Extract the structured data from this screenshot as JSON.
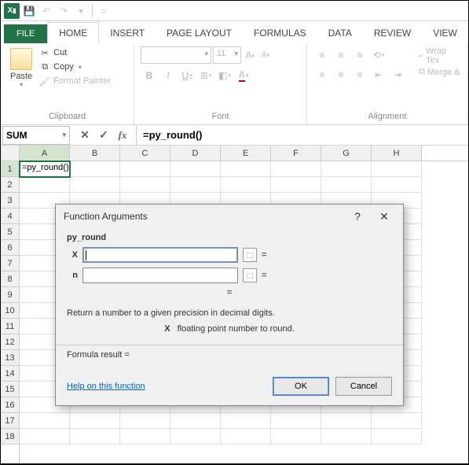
{
  "qat": {
    "app_abbr": "X"
  },
  "tabs": {
    "file": "FILE",
    "items": [
      "HOME",
      "INSERT",
      "PAGE LAYOUT",
      "FORMULAS",
      "DATA",
      "REVIEW",
      "VIEW"
    ],
    "active": "HOME"
  },
  "ribbon": {
    "clipboard": {
      "paste": "Paste",
      "cut": "Cut",
      "copy": "Copy",
      "format_painter": "Format Painter",
      "label": "Clipboard"
    },
    "font": {
      "size": "11",
      "increase": "A",
      "decrease": "A",
      "bold": "B",
      "italic": "I",
      "underline": "U",
      "label": "Font"
    },
    "alignment": {
      "wrap": "Wrap Tex",
      "merge": "Merge &",
      "label": "Alignment"
    }
  },
  "namebox": "SUM",
  "formula": "=py_round()",
  "columns": [
    "A",
    "B",
    "C",
    "D",
    "E",
    "F",
    "G",
    "H"
  ],
  "rows": [
    "1",
    "2",
    "3",
    "4",
    "5",
    "6",
    "7",
    "8",
    "9",
    "10",
    "11",
    "12",
    "13",
    "14",
    "15",
    "16",
    "17",
    "18"
  ],
  "cells": {
    "A1": "=py_round()"
  },
  "dialog": {
    "title": "Function Arguments",
    "help_glyph": "?",
    "func": "py_round",
    "args": [
      {
        "name": "X",
        "value": "",
        "focused": true
      },
      {
        "name": "n",
        "value": "",
        "focused": false
      }
    ],
    "eq": "=",
    "description": "Return a number to a given precision in decimal digits.",
    "arg_highlight_name": "X",
    "arg_highlight_desc": "floating point number to round.",
    "result_label": "Formula result =",
    "help": "Help on this function",
    "ok": "OK",
    "cancel": "Cancel"
  }
}
